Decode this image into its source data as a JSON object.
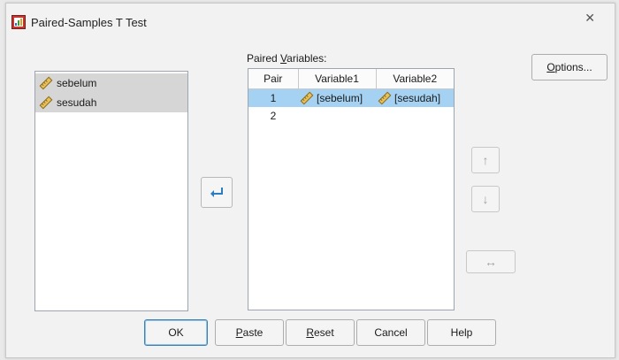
{
  "window": {
    "title": "Paired-Samples T Test",
    "close_glyph": "✕"
  },
  "source_list": {
    "items": [
      {
        "label": "sebelum"
      },
      {
        "label": "sesudah"
      }
    ]
  },
  "paired_variables": {
    "label_prefix": "Paired ",
    "label_accel": "V",
    "label_suffix": "ariables:",
    "columns": [
      "Pair",
      "Variable1",
      "Variable2"
    ],
    "rows": [
      {
        "pair": "1",
        "variable1": "[sebelum]",
        "variable2": "[sesudah]",
        "selected": true
      },
      {
        "pair": "2",
        "variable1": "",
        "variable2": "",
        "selected": false
      }
    ]
  },
  "side_buttons": {
    "up": "↑",
    "down": "↓",
    "swap": "↔"
  },
  "options_button": {
    "accel": "O",
    "rest": "ptions..."
  },
  "buttons": {
    "ok": "OK",
    "paste_accel": "P",
    "paste_rest": "aste",
    "reset_accel": "R",
    "reset_rest": "eset",
    "cancel": "Cancel",
    "help": "Help"
  },
  "colors": {
    "selection": "#a5d2f2",
    "move_arrow": "#2c7cc2"
  }
}
